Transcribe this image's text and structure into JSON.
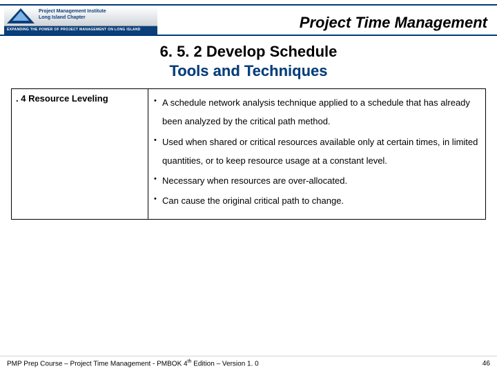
{
  "header": {
    "logo_line1": "Project Management Institute",
    "logo_line2": "Long Island Chapter",
    "logo_strap": "EXPANDING THE POWER OF PROJECT MANAGEMENT ON LONG ISLAND",
    "title": "Project Time Management"
  },
  "heading": {
    "line1": "6. 5. 2  Develop Schedule",
    "line2": "Tools and Techniques"
  },
  "table": {
    "left": ". 4 Resource Leveling",
    "bullets": [
      "A schedule network analysis technique applied to a schedule that has already been analyzed by the critical path method.",
      "Used when shared or critical resources available only at certain times, in limited quantities, or to keep resource usage at a constant level.",
      "Necessary when resources are over-allocated.",
      "Can cause the original critical path to change."
    ]
  },
  "footer": {
    "text_before": "PMP Prep Course – Project Time Management - PMBOK 4",
    "sup": "th",
    "text_after": " Edition – Version 1. 0",
    "page": "46"
  }
}
